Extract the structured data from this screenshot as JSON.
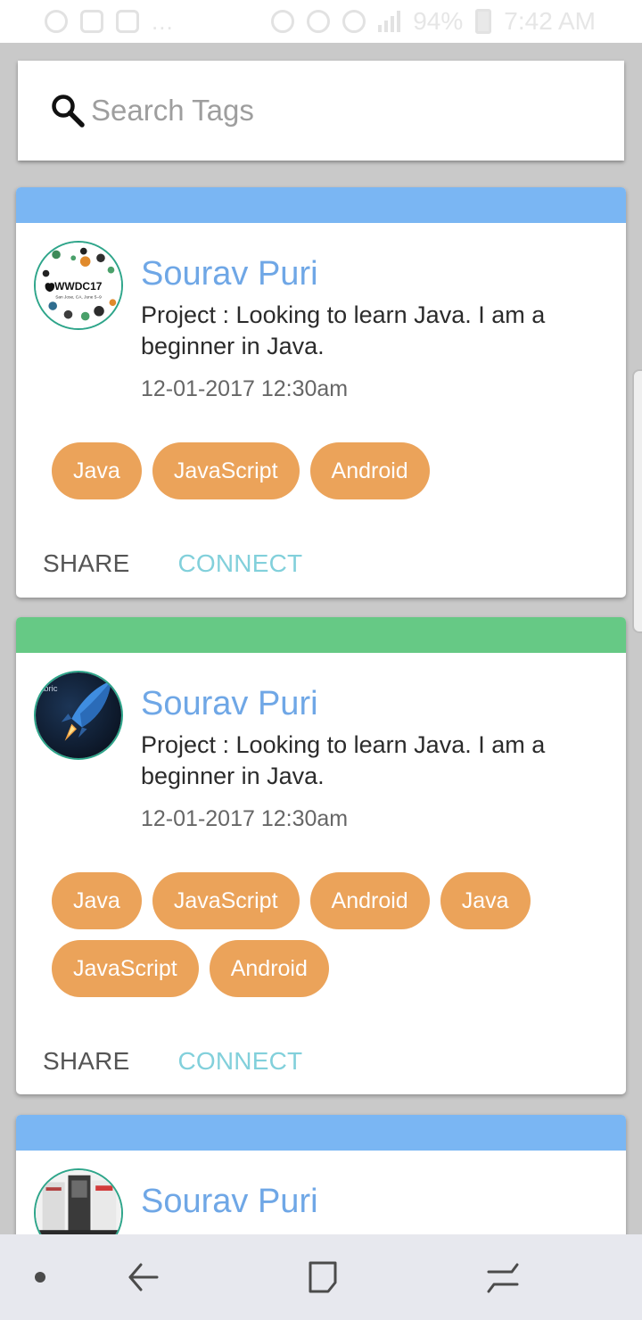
{
  "status_bar": {
    "battery": "94%",
    "time": "7:42 AM",
    "more": "...",
    "icons": [
      "whatsapp-icon",
      "gallery-icon",
      "cast-icon",
      "mute-icon",
      "alarm-icon",
      "wifi-icon",
      "signal-icon",
      "battery-icon"
    ]
  },
  "search": {
    "placeholder": "Search Tags",
    "value": "",
    "icon": "search-icon"
  },
  "cards": [
    {
      "band_color": "#7ab6f3",
      "avatar": "wwdc17-avatar",
      "name": "Sourav Puri",
      "description": "Project : Looking to learn Java. I am a beginner in Java.",
      "date": "12-01-2017 12:30am",
      "tags": [
        "Java",
        "JavaScript",
        "Android"
      ],
      "share_label": "SHARE",
      "connect_label": "CONNECT"
    },
    {
      "band_color": "#66c985",
      "avatar": "rocket-avatar",
      "avatar_text": "abric",
      "name": "Sourav Puri",
      "description": "Project : Looking to learn Java. I am a beginner in Java.",
      "date": "12-01-2017 12:30am",
      "tags": [
        "Java",
        "JavaScript",
        "Android",
        "Java",
        "JavaScript",
        "Android"
      ],
      "share_label": "SHARE",
      "connect_label": "CONNECT"
    },
    {
      "band_color": "#7ab6f3",
      "avatar": "screens-avatar",
      "name": "Sourav Puri"
    }
  ],
  "wwdc": {
    "title": "WWDC17",
    "subtitle": "San Jose, CA, June 5–9"
  },
  "colors": {
    "name": "#6fa7e6",
    "tag": "#eba35a",
    "connect": "#82d0db",
    "share": "#555555",
    "avatar_ring": "#2ea58a"
  },
  "nav": {
    "icons": [
      "home-dot-icon",
      "back-icon",
      "recents-icon",
      "switch-icon"
    ]
  }
}
